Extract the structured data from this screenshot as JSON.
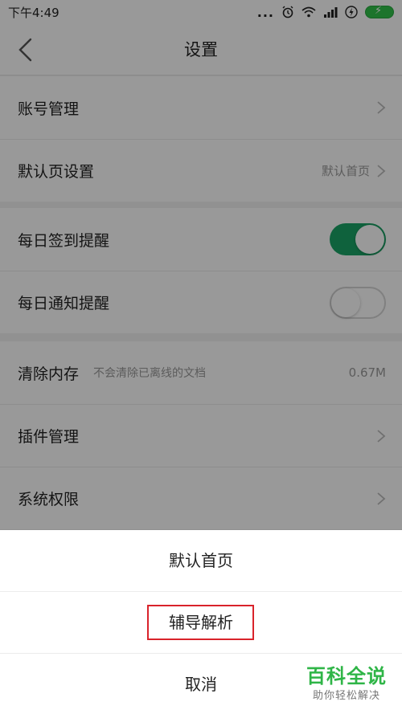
{
  "status_bar": {
    "time": "下午4:49",
    "dots": "...",
    "alarm_icon": "alarm-icon",
    "wifi_icon": "wifi-icon",
    "signal_icon": "signal-icon",
    "battery_icon": "battery-charging-icon"
  },
  "header": {
    "title": "设置",
    "back_icon": "chevron-left-icon"
  },
  "settings": {
    "account": {
      "label": "账号管理"
    },
    "default_page": {
      "label": "默认页设置",
      "value": "默认首页"
    },
    "daily_checkin": {
      "label": "每日签到提醒",
      "enabled": true
    },
    "daily_notify": {
      "label": "每日通知提醒",
      "enabled": false
    },
    "clear_cache": {
      "label": "清除内存",
      "hint": "不会清除已离线的文档",
      "size": "0.67M"
    },
    "plugins": {
      "label": "插件管理"
    },
    "permissions": {
      "label": "系统权限"
    }
  },
  "action_sheet": {
    "option_1": "默认首页",
    "option_2": "辅导解析",
    "cancel": "取消"
  },
  "watermark": {
    "main": "百科全说",
    "sub": "助你轻松解决"
  },
  "colors": {
    "toggle_on": "#1aa466",
    "highlight": "#d9232b",
    "watermark": "#2fb547"
  }
}
